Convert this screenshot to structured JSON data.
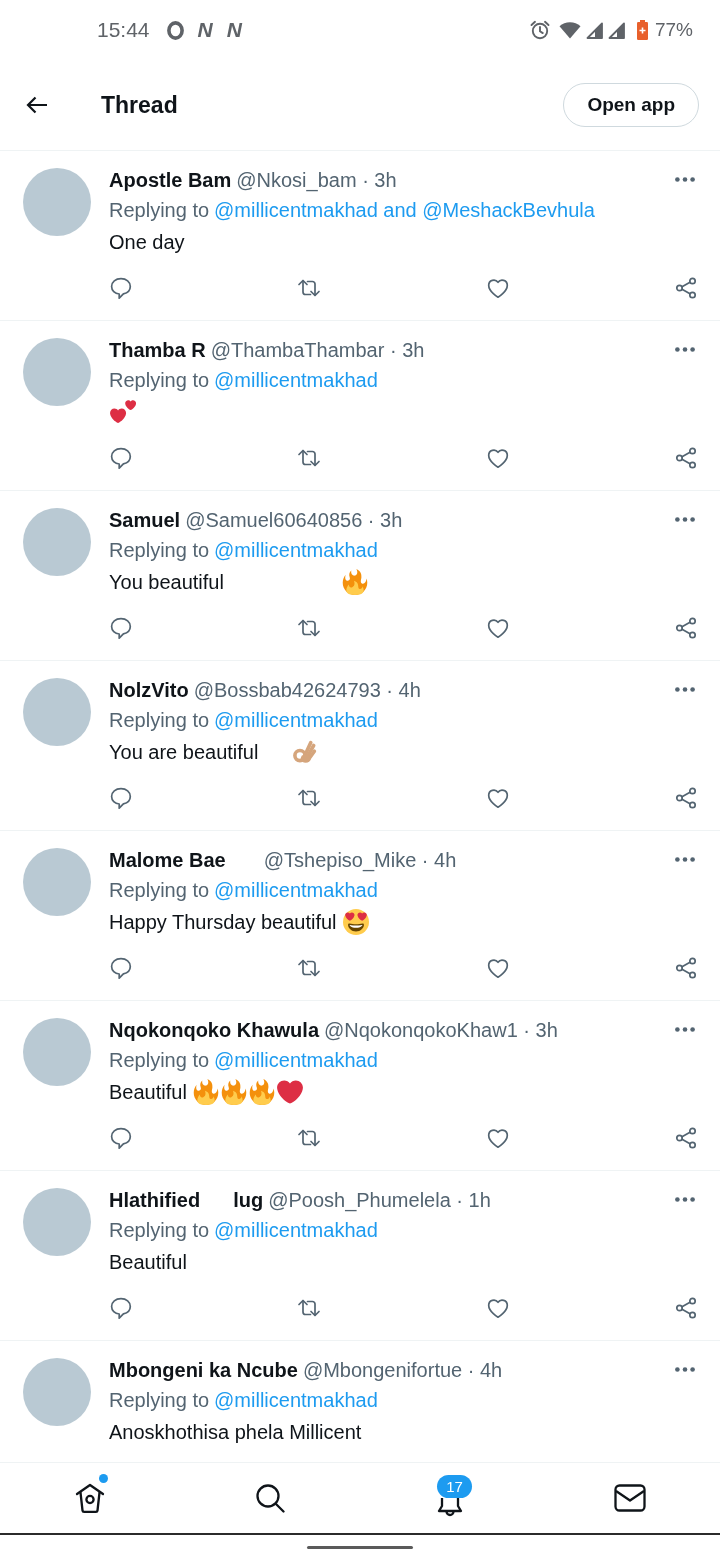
{
  "status_bar": {
    "time": "15:44",
    "app_glyphs": [
      "N",
      "N"
    ],
    "battery": "77%"
  },
  "header": {
    "title": "Thread",
    "action": "Open app"
  },
  "tweets": [
    {
      "author": [
        {
          "kind": "text",
          "text": "Apostle Bam"
        }
      ],
      "byline": "@Nkosi_bam · 3h",
      "replying_label": "Replying to",
      "replying_to": "@millicentmakhad and @MeshackBevhula",
      "body": [
        {
          "kind": "text",
          "text": "One day"
        }
      ]
    },
    {
      "author": [
        {
          "kind": "text",
          "text": "Thamba R"
        }
      ],
      "byline": "@ThambaThambar · 3h",
      "replying_label": "Replying to",
      "replying_to": "@millicentmakhad",
      "body": [
        {
          "kind": "two_hearts"
        }
      ]
    },
    {
      "author": [
        {
          "kind": "text",
          "text": "Samuel"
        }
      ],
      "byline": "@Samuel60640856 · 3h",
      "replying_label": "Replying to",
      "replying_to": "@millicentmakhad",
      "body": [
        {
          "kind": "text",
          "text": "You beautiful"
        },
        {
          "kind": "blank"
        },
        {
          "kind": "blank"
        },
        {
          "kind": "blank"
        },
        {
          "kind": "blank"
        },
        {
          "kind": "fire"
        }
      ]
    },
    {
      "author": [
        {
          "kind": "text",
          "text": "NolzVito"
        }
      ],
      "byline": "@Bossbab42624793 · 4h",
      "replying_label": "Replying to",
      "replying_to": "@millicentmakhad",
      "body": [
        {
          "kind": "text",
          "text": "You are beautiful"
        },
        {
          "kind": "blank"
        },
        {
          "kind": "ok_hand"
        }
      ]
    },
    {
      "author": [
        {
          "kind": "text",
          "text": "Malome Bae"
        },
        {
          "kind": "blank"
        }
      ],
      "byline": "@Tshepiso_Mike · 4h",
      "replying_label": "Replying to",
      "replying_to": "@millicentmakhad",
      "body": [
        {
          "kind": "text",
          "text": "Happy Thursday beautiful"
        },
        {
          "kind": "heart_eyes"
        }
      ]
    },
    {
      "author": [
        {
          "kind": "text",
          "text": "Nqokonqoko Khawula"
        }
      ],
      "byline": "@NqokonqokoKhaw1 · 3h",
      "replying_label": "Replying to",
      "replying_to": "@millicentmakhad",
      "body": [
        {
          "kind": "text",
          "text": "Beautiful"
        },
        {
          "kind": "fire"
        },
        {
          "kind": "fire"
        },
        {
          "kind": "fire"
        },
        {
          "kind": "heart"
        }
      ]
    },
    {
      "author": [
        {
          "kind": "text",
          "text": "Hlathified"
        },
        {
          "kind": "blank"
        },
        {
          "kind": "text",
          "text": "lug"
        }
      ],
      "byline": "@Poosh_Phumelela · 1h",
      "replying_label": "Replying to",
      "replying_to": "@millicentmakhad",
      "body": [
        {
          "kind": "text",
          "text": "Beautiful"
        }
      ]
    },
    {
      "author": [
        {
          "kind": "text",
          "text": "Mbongeni ka Ncube"
        }
      ],
      "byline": "@Mbongenifortue · 4h",
      "replying_label": "Replying to",
      "replying_to": "@millicentmakhad",
      "body": [
        {
          "kind": "text",
          "text": "Anoskhothisa phela Millicent"
        }
      ]
    }
  ],
  "nav": [
    {
      "kind": "home",
      "has_new": true
    },
    {
      "kind": "search",
      "has_new": false
    },
    {
      "kind": "notifications",
      "has_new": false,
      "badge": "17"
    },
    {
      "kind": "messages",
      "has_new": false
    }
  ]
}
